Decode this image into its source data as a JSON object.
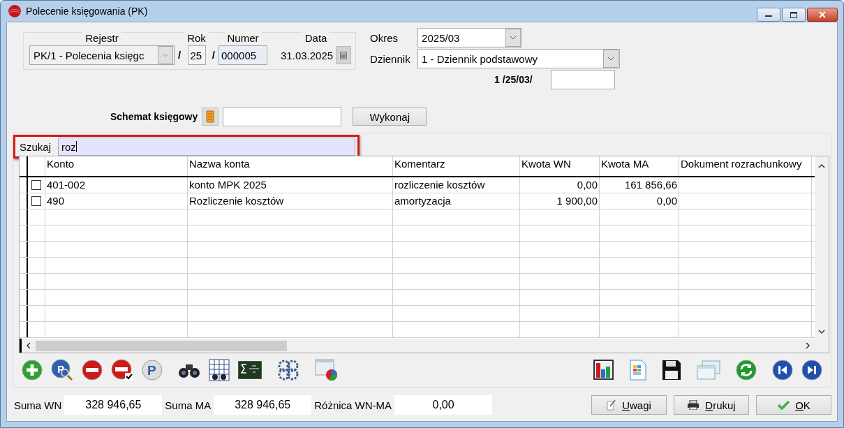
{
  "window": {
    "title": "Polecenie księgowania (PK)"
  },
  "header": {
    "rejestr": {
      "label": "Rejestr",
      "value": "PK/1   - Polecenia księgc"
    },
    "rok": {
      "label": "Rok",
      "value": "25"
    },
    "numer": {
      "label": "Numer",
      "value": "000005"
    },
    "data": {
      "label": "Data",
      "value": "31.03.2025"
    },
    "separators": [
      "/",
      "/"
    ]
  },
  "okres": {
    "label": "Okres",
    "value": "2025/03"
  },
  "dziennik": {
    "label": "Dziennik",
    "value": "1  - Dziennik podstawowy"
  },
  "numer_dziennika": {
    "prefix": "1 /25/03/"
  },
  "schemat": {
    "label": "Schemat księgowy",
    "button": "Wykonaj"
  },
  "search": {
    "label": "Szukaj",
    "value": "roz",
    "highlighted": true
  },
  "table": {
    "columns": [
      "Konto",
      "Nazwa konta",
      "Komentarz",
      "Kwota WN",
      "Kwota MA",
      "Dokument rozrachunkowy"
    ],
    "rows": [
      {
        "checked": false,
        "cells": [
          "401-002",
          "konto MPK 2025",
          "rozliczenie kosztów",
          "0,00",
          "161 856,66"
        ]
      },
      {
        "checked": false,
        "cells": [
          "490",
          "Rozliczenie kosztów",
          "amortyzacja",
          "1 900,00",
          "0,00"
        ]
      }
    ]
  },
  "toolbar": {
    "preview_glyph": "P",
    "post_glyph": "P"
  },
  "summary": [
    {
      "label": "Suma WN",
      "value": "328 946,65"
    },
    {
      "label": "Suma MA",
      "value": "328 946,65"
    },
    {
      "label": "Różnica WN-MA",
      "value": "0,00"
    }
  ],
  "buttons": [
    {
      "kind": "notes",
      "label": "Uwagi"
    },
    {
      "kind": "print",
      "label": "Drukuj"
    },
    {
      "kind": "ok",
      "label": "OK"
    }
  ]
}
